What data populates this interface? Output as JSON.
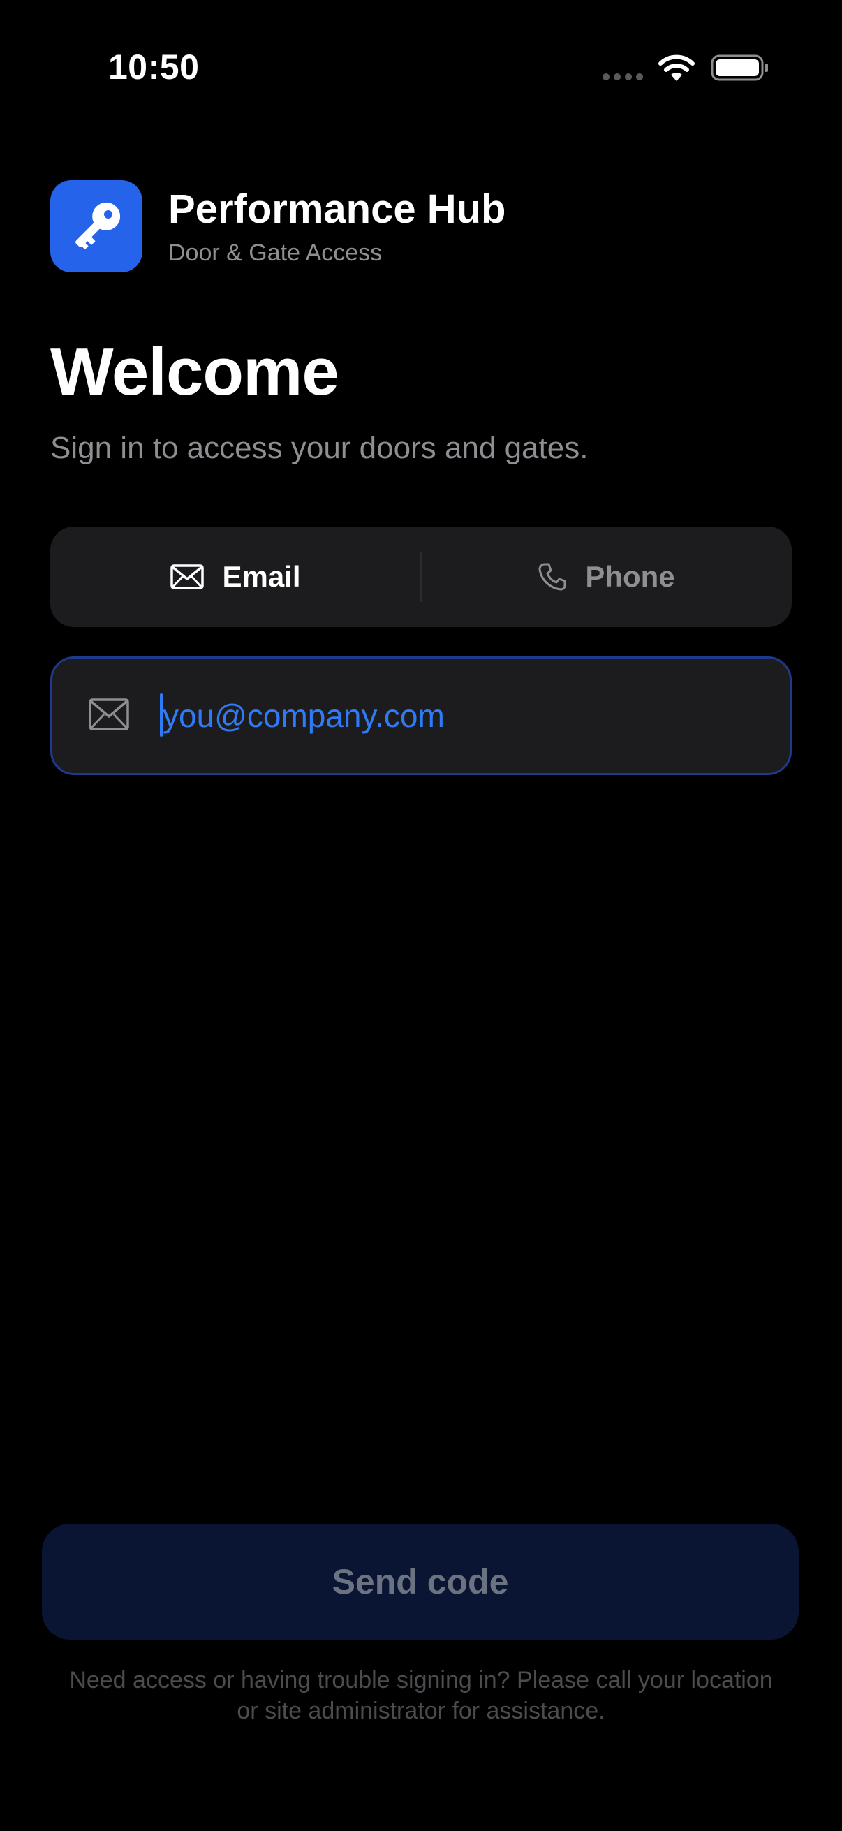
{
  "status_bar": {
    "time": "10:50",
    "icons": [
      "cellular-dots-icon",
      "wifi-icon",
      "battery-icon"
    ]
  },
  "brand": {
    "app_icon": "key-icon",
    "title": "Performance Hub",
    "subtitle": "Door & Gate Access",
    "accent_color": "#2563EB"
  },
  "welcome": {
    "title": "Welcome",
    "subtitle": "Sign in to access your doors and gates."
  },
  "sign_in_method": {
    "options": [
      {
        "label": "Email",
        "icon": "envelope-icon",
        "selected": true
      },
      {
        "label": "Phone",
        "icon": "phone-icon",
        "selected": false
      }
    ]
  },
  "email_input": {
    "icon": "envelope-icon",
    "value": "",
    "placeholder": "you@company.com"
  },
  "send_button": {
    "label": "Send code",
    "enabled": false
  },
  "help": {
    "text": "Need access or having trouble signing in? Please call your location or site administrator for assistance."
  }
}
